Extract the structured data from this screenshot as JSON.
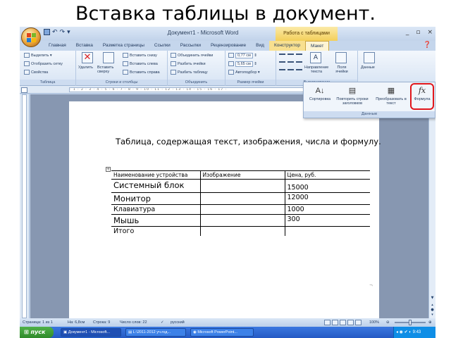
{
  "slide_title": "Вставка таблицы в документ.",
  "window": {
    "title": "Документ1 - Microsoft Word",
    "context_tab_title": "Работа с таблицами",
    "controls": [
      "_",
      "▫",
      "×"
    ]
  },
  "tabs": [
    "Главная",
    "Вставка",
    "Разметка страницы",
    "Ссылки",
    "Рассылки",
    "Рецензирование",
    "Вид",
    "Конструктор",
    "Макет"
  ],
  "active_tab": "Макет",
  "ribbon": {
    "table_group": {
      "label": "Таблица",
      "items": [
        "Выделить ▾",
        "Отобразить сетку",
        "Свойства"
      ]
    },
    "rows_group": {
      "label": "Строки и столбцы",
      "delete_label": "Удалить",
      "insert_above_label": "Вставить сверху",
      "items": [
        "Вставить снизу",
        "Вставить слева",
        "Вставить справа"
      ]
    },
    "merge_group": {
      "label": "Объединить",
      "items": [
        "Объединить ячейки",
        "Разбить ячейки",
        "Разбить таблицу"
      ]
    },
    "size_group": {
      "label": "Размер ячейки",
      "height": "0,77 см",
      "width": "5,65 см",
      "autofit": "Автоподбор ▾"
    },
    "align_group": {
      "label": "Выравнивание",
      "direction_label": "Направление текста",
      "margins_label": "Поля ячейки"
    },
    "data_label": "Данные"
  },
  "data_popup": {
    "group_label": "Данные",
    "items": [
      "Сортировка",
      "Повторить строки заголовков",
      "Преобразовать в текст",
      "Формула"
    ]
  },
  "document": {
    "heading": "Таблица, содержащая текст, изображения, числа и формулу.",
    "table_handle": "+",
    "table": {
      "headers": [
        "Наименование устройства",
        "Изображение",
        "Цена, руб."
      ],
      "rows": [
        {
          "name": "Системный блок",
          "image": "",
          "price": "15000"
        },
        {
          "name": "Монитор",
          "image": "",
          "price": "12000"
        },
        {
          "name": "Клавиатура",
          "image": "",
          "price": "1000"
        },
        {
          "name": "Мышь",
          "image": "",
          "price": "300"
        },
        {
          "name": "Итого",
          "image": "",
          "price": ""
        }
      ]
    }
  },
  "statusbar": {
    "page": "Страница: 1 из 1",
    "section": "На: 6,8см",
    "line": "Строка: 9",
    "words": "Число слов: 22",
    "language": "русский",
    "zoom": "100%"
  },
  "taskbar": {
    "start": "пуск",
    "tasks": [
      "Документ1 - Microsoft...",
      "L:\\2011-2012 уч.год...",
      "Microsoft PowerPoint..."
    ],
    "clock": "9:43"
  }
}
